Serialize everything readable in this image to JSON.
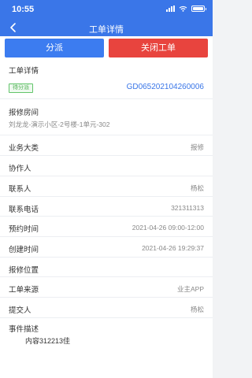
{
  "status_bar": {
    "time": "10:55"
  },
  "nav": {
    "title": "工单详情"
  },
  "actions": {
    "dispatch": "分派",
    "close": "关闭工单"
  },
  "header": {
    "section": "工单详情",
    "status": "待分派",
    "order_no": "GD065202104260006"
  },
  "room": {
    "label": "报修房间",
    "value": "刘龙龙-演示小区-2号楼-1单元-302"
  },
  "fields": [
    {
      "label": "业务大类",
      "value": "报修"
    },
    {
      "label": "协作人",
      "value": ""
    },
    {
      "label": "联系人",
      "value": "杨松"
    },
    {
      "label": "联系电话",
      "value": "321311313"
    },
    {
      "label": "预约时间",
      "value": "2021-04-26 09:00-12:00"
    },
    {
      "label": "创建时间",
      "value": "2021-04-26 19:29:37"
    },
    {
      "label": "报修位置",
      "value": ""
    },
    {
      "label": "工单来源",
      "value": "业主APP"
    },
    {
      "label": "提交人",
      "value": "杨松"
    }
  ],
  "description": {
    "label": "事件描述",
    "value": "内容312213佳"
  },
  "colors": {
    "primary": "#3a76e8",
    "danger": "#e8443e",
    "status_green": "#4caf50"
  }
}
